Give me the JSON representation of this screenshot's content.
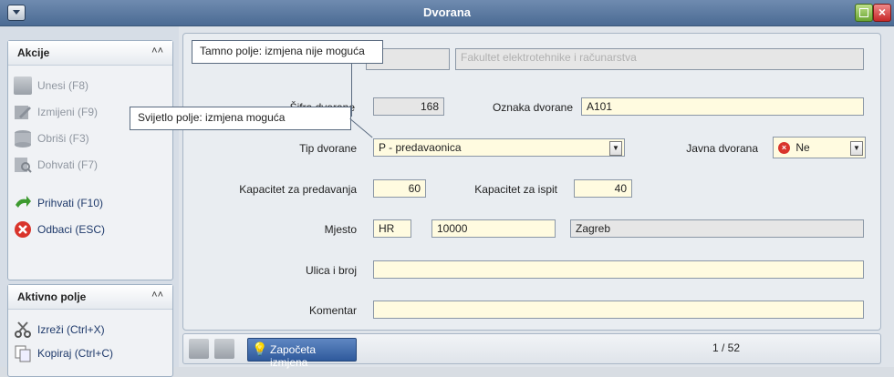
{
  "window": {
    "title": "Dvorana"
  },
  "sidebar": {
    "akcije": {
      "title": "Akcije",
      "items": [
        {
          "label": "Unesi (F8)"
        },
        {
          "label": "Izmijeni (F9)"
        },
        {
          "label": "Obriši (F3)"
        },
        {
          "label": "Dohvati (F7)"
        },
        {
          "label": "Prihvati (F10)"
        },
        {
          "label": "Odbaci (ESC)"
        }
      ]
    },
    "aktivno_polje": {
      "title": "Aktivno polje",
      "items": [
        {
          "label": "Izreži (Ctrl+X)"
        },
        {
          "label": "Kopiraj (Ctrl+C)"
        }
      ]
    }
  },
  "form": {
    "top_field": "Fakultet elektrotehnike i računarstva",
    "sifra_label": "Šifra dvorane",
    "sifra_value": "168",
    "oznaka_label": "Oznaka dvorane",
    "oznaka_value": "A101",
    "tip_label": "Tip dvorane",
    "tip_value": "P - predavaonica",
    "javna_label": "Javna dvorana",
    "javna_value": "Ne",
    "kap_pred_label": "Kapacitet za predavanja",
    "kap_pred_value": "60",
    "kap_isp_label": "Kapacitet za ispit",
    "kap_isp_value": "40",
    "mjesto_label": "Mjesto",
    "mjesto_country": "HR",
    "mjesto_post": "10000",
    "mjesto_city": "Zagreb",
    "ulica_label": "Ulica i broj",
    "ulica_value": "",
    "komentar_label": "Komentar",
    "komentar_value": ""
  },
  "callouts": {
    "dark": "Tamno polje: izmjena nije moguća",
    "light": "Svijetlo polje: izmjena moguća"
  },
  "status": {
    "mode": "Započeta izmjena",
    "record": "1 / 52"
  },
  "colors": {
    "editable_bg": "#fffbe0",
    "readonly_bg": "#e6e6e6"
  }
}
